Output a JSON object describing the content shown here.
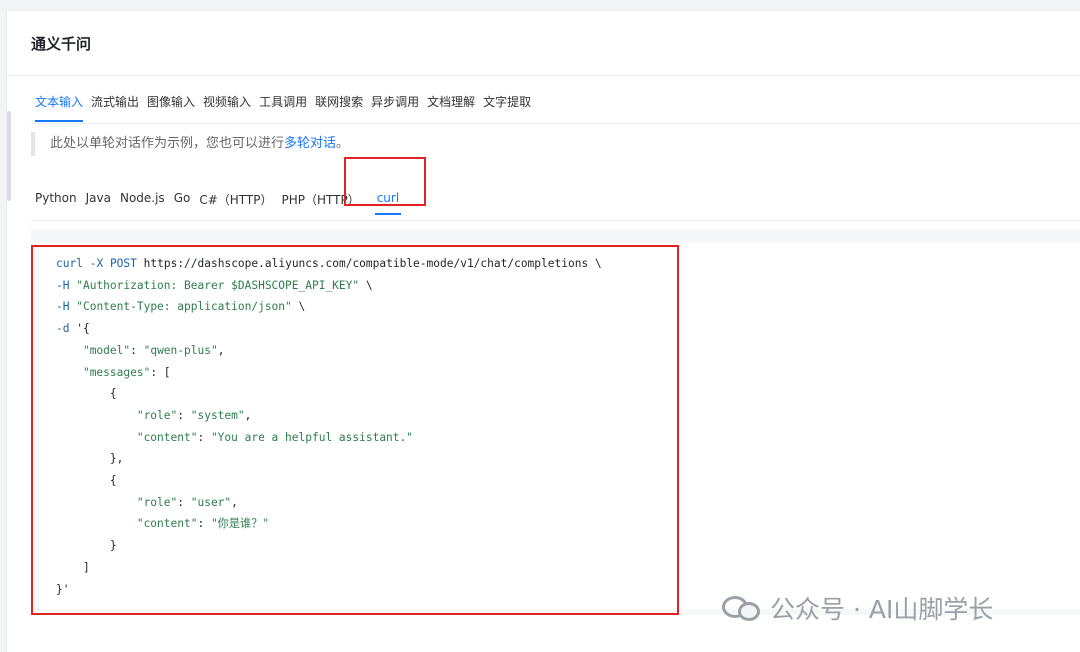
{
  "header": {
    "title": "通义千问"
  },
  "tabs": [
    {
      "label": "文本输入",
      "active": true
    },
    {
      "label": "流式输出",
      "active": false
    },
    {
      "label": "图像输入",
      "active": false
    },
    {
      "label": "视频输入",
      "active": false
    },
    {
      "label": "工具调用",
      "active": false
    },
    {
      "label": "联网搜索",
      "active": false
    },
    {
      "label": "异步调用",
      "active": false
    },
    {
      "label": "文档理解",
      "active": false
    },
    {
      "label": "文字提取",
      "active": false
    }
  ],
  "note": {
    "text": "此处以单轮对话作为示例，您也可以进行",
    "link": "多轮对话",
    "suffix": "。"
  },
  "languages": [
    {
      "label": "Python",
      "active": false
    },
    {
      "label": "Java",
      "active": false
    },
    {
      "label": "Node.js",
      "active": false
    },
    {
      "label": "Go",
      "active": false
    },
    {
      "label": "C#（HTTP）",
      "active": false
    },
    {
      "label": "PHP（HTTP）",
      "active": false
    },
    {
      "label": "curl",
      "active": true
    }
  ],
  "code": {
    "l1_cmd": "curl",
    "l1_flag": "-X",
    "l1_method": "POST",
    "l1_url": "https://dashscope.aliyuncs.com/compatible-mode/v1/chat/completions \\",
    "l2_flag": "-H",
    "l2_str": "\"Authorization: Bearer $DASHSCOPE_API_KEY\"",
    "l2_tail": " \\",
    "l3_flag": "-H",
    "l3_str": "\"Content-Type: application/json\"",
    "l3_tail": " \\",
    "l4_flag": "-d",
    "l4_open": " '{",
    "model_key": "\"model\"",
    "model_val": "\"qwen-plus\"",
    "messages_key": "\"messages\"",
    "role_key": "\"role\"",
    "role1_val": "\"system\"",
    "content_key": "\"content\"",
    "content1_val": "\"You are a helpful assistant.\"",
    "role2_val": "\"user\"",
    "content2_val": "\"你是谁？\"",
    "close": "}'"
  },
  "watermark": {
    "text": "公众号 · AI山脚学长",
    "icon": "wechat-icon"
  },
  "colors": {
    "accent": "#1677ff",
    "highlight": "#e02424"
  }
}
